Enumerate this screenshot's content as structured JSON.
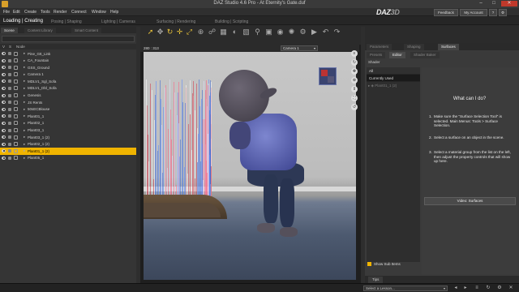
{
  "window": {
    "title": "DAZ Studio 4.6 Pro - At Eternity's Gate.duf",
    "minimize": "–",
    "maximize": "□",
    "close": "✕"
  },
  "menu": [
    "File",
    "Edit",
    "Create",
    "Tools",
    "Render",
    "Connect",
    "Window",
    "Help"
  ],
  "brand": {
    "logo_main": "DAZ",
    "logo_sub": "3D"
  },
  "top_buttons": {
    "feedback": "Feedback",
    "account": "My Account"
  },
  "layout_tabs": [
    "Loading | Creating",
    "Posing | Shaping",
    "Lighting | Cameras",
    "Surfacing | Rendering",
    "Building | Scripting"
  ],
  "scene_panel": {
    "tabs": [
      "Scene",
      "Content Library",
      "Smart Content"
    ],
    "columns": {
      "visible": "V",
      "selectable": "S",
      "node": "Node"
    },
    "nodes": [
      {
        "label": "Pine_Gtt_Link",
        "selected": false
      },
      {
        "label": "CA_Fountain",
        "selected": false
      },
      {
        "label": "GSS_Ground",
        "selected": false
      },
      {
        "label": "Camera 1",
        "selected": false
      },
      {
        "label": "MDLV1_Sgl_Sofa",
        "selected": false
      },
      {
        "label": "MDLV1_Dbl_Sofa",
        "selected": false
      },
      {
        "label": "Genesis",
        "selected": false
      },
      {
        "label": "JS Rents",
        "selected": false
      },
      {
        "label": "50sECBlouse",
        "selected": false
      },
      {
        "label": "Plant01_1",
        "selected": false
      },
      {
        "label": "Plant02_1",
        "selected": false
      },
      {
        "label": "Plant03_1",
        "selected": false
      },
      {
        "label": "Plant03_1 (2)",
        "selected": false
      },
      {
        "label": "Plant02_1 (2)",
        "selected": false
      },
      {
        "label": "Plant01_1 (2)",
        "selected": true
      },
      {
        "label": "Plant05_1",
        "selected": false
      }
    ]
  },
  "viewport": {
    "coords": "280 : 313",
    "camera": "Camera 1"
  },
  "surfaces_panel": {
    "outer_tabs": [
      "Parameters",
      "Shaping",
      "Surfaces"
    ],
    "inner_tabs": [
      "Presets",
      "Editor",
      "Shader Baker"
    ],
    "shader_label": "Shader",
    "shader_items": [
      "All",
      "Currently Used"
    ],
    "tree_item": "Plant01_1 (2)",
    "help_title": "What can I do?",
    "help_steps": [
      {
        "num": "1.",
        "text": "Make sure the \"Surface Selection Tool\" is selected. Main Menus: Tools > Surface Selection."
      },
      {
        "num": "2.",
        "text": "Select a surface on an object in the scene."
      },
      {
        "num": "3.",
        "text": "Select a material group from the list on the left, then adjust the property controls that will show up here."
      }
    ],
    "video_button": "Video: Surfaces",
    "show_sub_items": "Show Sub Items"
  },
  "tips": {
    "label": "Tips"
  },
  "statusbar": {
    "lesson_placeholder": "Select a Lesson..."
  },
  "colors": {
    "accent": "#f0b400",
    "background": "#2b2b2b"
  }
}
